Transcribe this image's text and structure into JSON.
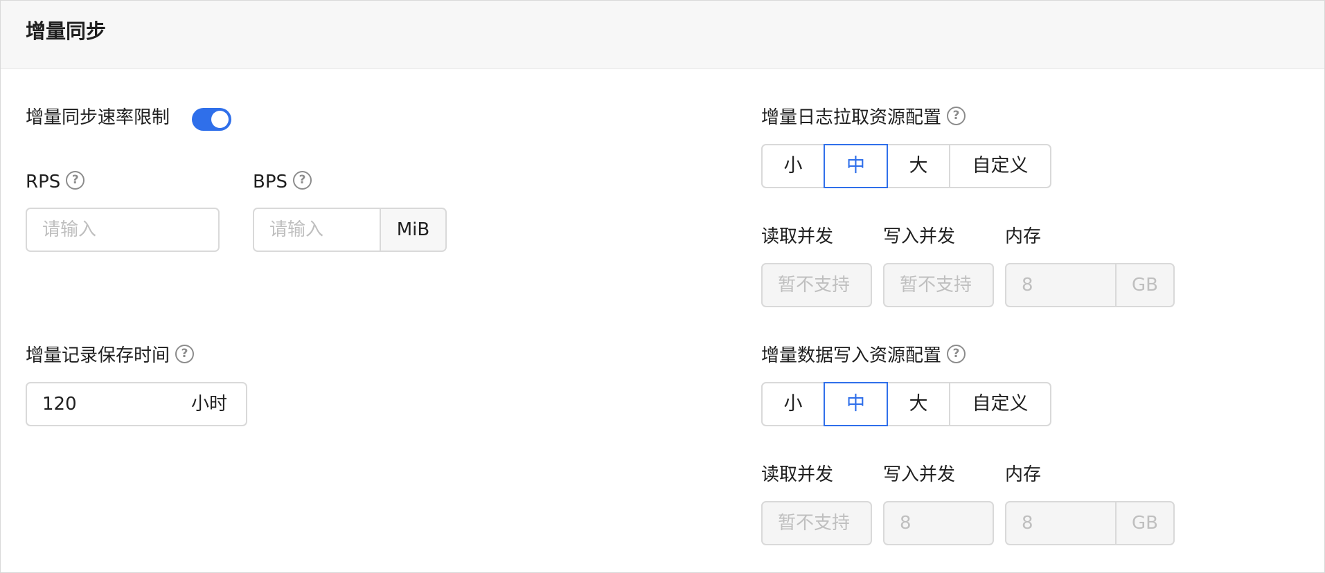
{
  "panel": {
    "title": "增量同步"
  },
  "left": {
    "rate_limit_label": "增量同步速率限制",
    "rate_limit_enabled": true,
    "rps": {
      "label": "RPS",
      "placeholder": "请输入"
    },
    "bps": {
      "label": "BPS",
      "placeholder": "请输入",
      "unit": "MiB"
    },
    "retention": {
      "label": "增量记录保存时间",
      "value": "120",
      "unit": "小时"
    }
  },
  "right": {
    "log_pull": {
      "label": "增量日志拉取资源配置",
      "options": [
        "小",
        "中",
        "大",
        "自定义"
      ],
      "selected": "中",
      "fields": {
        "read_label": "读取并发",
        "read_value": "暂不支持",
        "write_label": "写入并发",
        "write_value": "暂不支持",
        "memory_label": "内存",
        "memory_value": "8",
        "memory_unit": "GB"
      }
    },
    "data_write": {
      "label": "增量数据写入资源配置",
      "options": [
        "小",
        "中",
        "大",
        "自定义"
      ],
      "selected": "中",
      "fields": {
        "read_label": "读取并发",
        "read_value": "暂不支持",
        "write_label": "写入并发",
        "write_value": "8",
        "memory_label": "内存",
        "memory_value": "8",
        "memory_unit": "GB"
      }
    }
  },
  "colors": {
    "accent": "#2f6fea",
    "border": "#d9d9d9",
    "header_bg": "#f7f7f7"
  }
}
